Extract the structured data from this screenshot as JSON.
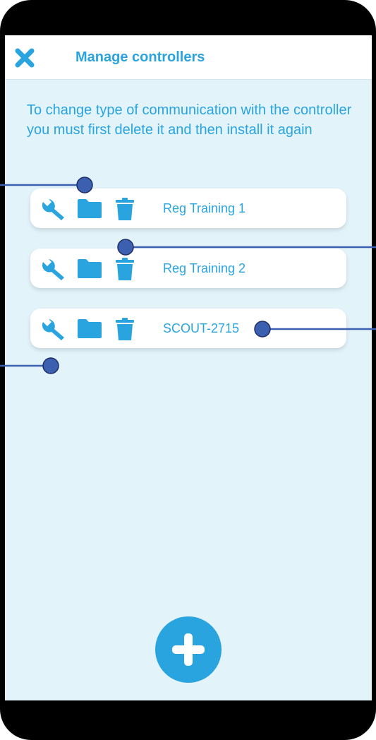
{
  "header": {
    "title": "Manage controllers",
    "close_icon": "close-icon"
  },
  "info_text": "To change type of communication with the controller you must first delete it and then install it again",
  "controllers": [
    {
      "name": "Reg Training 1",
      "icons": [
        "wrench-icon",
        "folder-icon",
        "trash-icon"
      ]
    },
    {
      "name": "Reg Training 2",
      "icons": [
        "wrench-icon",
        "folder-icon",
        "trash-icon"
      ]
    },
    {
      "name": "SCOUT-2715",
      "icons": [
        "wrench-icon",
        "folder-icon",
        "trash-icon"
      ]
    }
  ],
  "add_button_icon": "plus-icon",
  "colors": {
    "accent": "#2aa4df",
    "screen_background": "#e2f3fa",
    "header_background": "#ffffff",
    "phone_frame": "#000000",
    "annotation_line": "#3d5fb0"
  }
}
